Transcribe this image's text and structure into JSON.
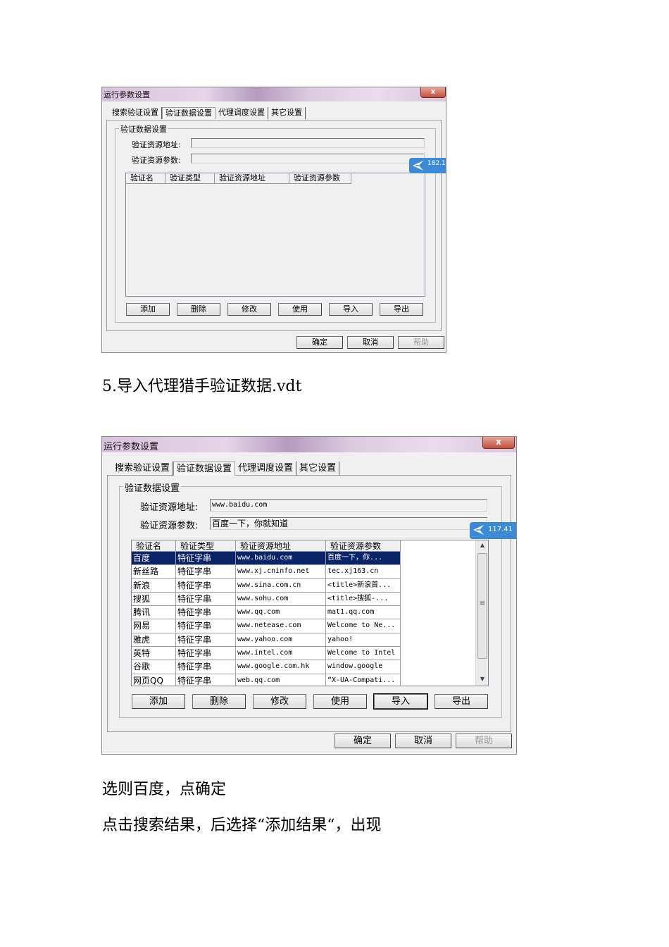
{
  "dialog1": {
    "title": "运行参数设置",
    "close": "x",
    "tabs": [
      "搜索验证设置",
      "验证数据设置",
      "代理调度设置",
      "其它设置"
    ],
    "group_title": "验证数据设置",
    "addr_label": "验证资源地址:",
    "addr_value": "",
    "param_label": "验证资源参数:",
    "param_value": "",
    "columns": [
      "验证名",
      "验证类型",
      "验证资源地址",
      "验证资源参数"
    ],
    "buttons": [
      "添加",
      "删除",
      "修改",
      "使用",
      "导入",
      "导出"
    ],
    "footer": [
      "确定",
      "取消",
      "帮助"
    ],
    "badge": "182.1"
  },
  "caption1": "5.导入代理猎手验证数据.vdt",
  "dialog2": {
    "title": "运行参数设置",
    "close": "x",
    "tabs": [
      "搜索验证设置",
      "验证数据设置",
      "代理调度设置",
      "其它设置"
    ],
    "group_title": "验证数据设置",
    "addr_label": "验证资源地址:",
    "addr_value": "www.baidu.com",
    "param_label": "验证资源参数:",
    "param_value": "百度一下，你就知道",
    "columns": [
      "验证名",
      "验证类型",
      "验证资源地址",
      "验证资源参数"
    ],
    "rows": [
      [
        "百度",
        "特征字串",
        "www.baidu.com",
        "百度一下，你..."
      ],
      [
        "新丝路",
        "特征字串",
        "www.xj.cninfo.net",
        "tec.xj163.cn"
      ],
      [
        "新浪",
        "特征字串",
        "www.sina.com.cn",
        "<title>新浪首..."
      ],
      [
        "搜狐",
        "特征字串",
        "www.sohu.com",
        "<title>搜狐-..."
      ],
      [
        "腾讯",
        "特征字串",
        "www.qq.com",
        "mat1.qq.com"
      ],
      [
        "网易",
        "特征字串",
        "www.netease.com",
        "Welcome to Ne..."
      ],
      [
        "雅虎",
        "特征字串",
        "www.yahoo.com",
        "yahoo!"
      ],
      [
        "英特",
        "特征字串",
        "www.intel.com",
        "Welcome to Intel"
      ],
      [
        "谷歌",
        "特征字串",
        "www.google.com.hk",
        "window.google"
      ],
      [
        "网页QQ",
        "特征字串",
        "web.qq.com",
        "“X-UA-Compati..."
      ]
    ],
    "buttons": [
      "添加",
      "删除",
      "修改",
      "使用",
      "导入",
      "导出"
    ],
    "footer": [
      "确定",
      "取消",
      "帮助"
    ],
    "badge": "117.41"
  },
  "caption2": "选则百度，点确定",
  "caption3": "点击搜索结果，后选择“添加结果“，出现"
}
